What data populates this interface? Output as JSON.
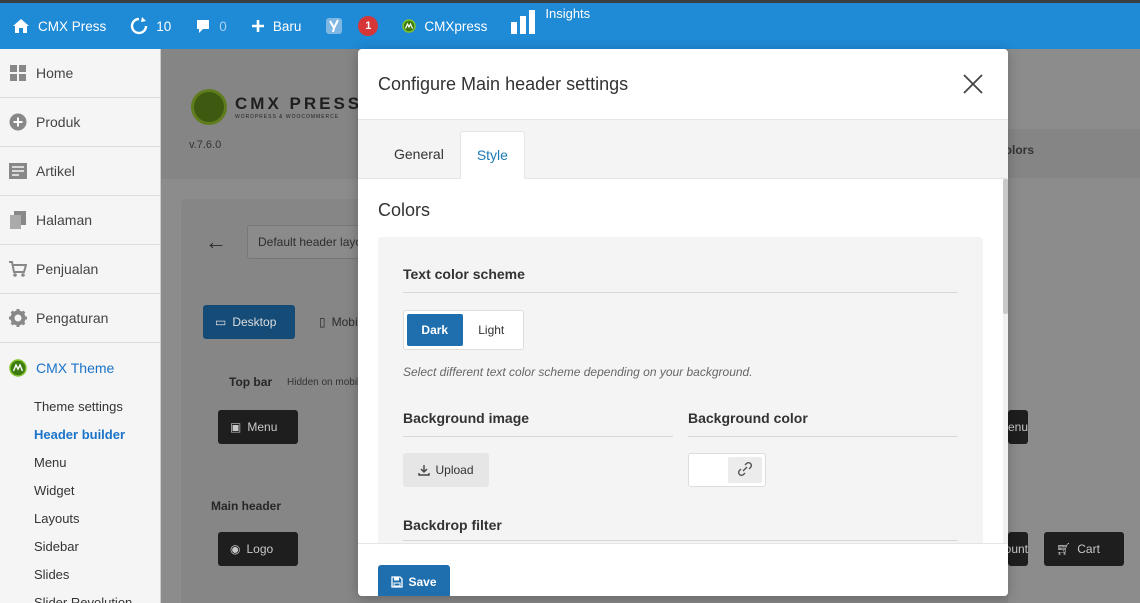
{
  "adminbar": {
    "site_name": "CMX Press",
    "updates_count": "10",
    "comments_count": "0",
    "new_label": "Baru",
    "yoast_badge": "1",
    "cmx_label": "CMXpress",
    "insights_label": "Insights"
  },
  "sidebar": {
    "items": [
      {
        "label": "Home"
      },
      {
        "label": "Produk"
      },
      {
        "label": "Artikel"
      },
      {
        "label": "Halaman"
      },
      {
        "label": "Penjualan"
      },
      {
        "label": "Pengaturan"
      },
      {
        "label": "CMX Theme"
      }
    ],
    "submenu": [
      {
        "label": "Theme settings"
      },
      {
        "label": "Header builder"
      },
      {
        "label": "Menu"
      },
      {
        "label": "Widget"
      },
      {
        "label": "Layouts"
      },
      {
        "label": "Sidebar"
      },
      {
        "label": "Slides"
      },
      {
        "label": "Slider Revolution"
      }
    ]
  },
  "background": {
    "logo_text": "CMX PRESS",
    "logo_tagline": "WORDPRESS & WOOCOMMERCE",
    "version": "v.7.6.0",
    "layout_input": "Default header layout",
    "desktop_btn": "Desktop",
    "mobile_btn": "Mobile",
    "top_bar_label": "Top bar",
    "hidden_label": "Hidden on mobile",
    "menu_btn": "Menu",
    "main_header_label": "Main header",
    "logo_btn": "Logo",
    "account_btn": "Account",
    "cart_btn": "Cart",
    "colors_label": "Colors",
    "partial_btn": "Menu"
  },
  "modal": {
    "title": "Configure Main header settings",
    "tabs": [
      {
        "label": "General"
      },
      {
        "label": "Style"
      }
    ],
    "section_title": "Colors",
    "text_color_scheme_label": "Text color scheme",
    "scheme_dark": "Dark",
    "scheme_light": "Light",
    "scheme_hint": "Select different text color scheme depending on your background.",
    "bg_image_label": "Background image",
    "bg_color_label": "Background color",
    "upload_label": "Upload",
    "backdrop_label": "Backdrop filter",
    "save_label": "Save"
  },
  "colors": {
    "admin_bar": "#1f8ad6",
    "accent": "#1f6fae",
    "active_link": "#1a73c9",
    "badge": "#d63638"
  }
}
